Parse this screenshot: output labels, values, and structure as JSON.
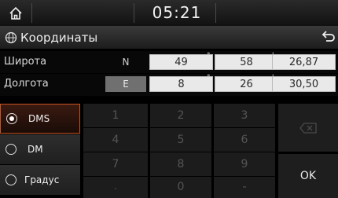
{
  "status": {
    "time": "05:21",
    "home_icon": "home-icon"
  },
  "header": {
    "title": "Координаты",
    "title_icon": "globe-icon",
    "back_icon": "back-arrow-icon"
  },
  "coordinates": {
    "latitude": {
      "label": "Широта",
      "direction": "N",
      "degrees": "49",
      "minutes": "58",
      "seconds": "26,87"
    },
    "longitude": {
      "label": "Долгота",
      "direction": "E",
      "degrees": "8",
      "minutes": "26",
      "seconds": "30,50"
    },
    "units": {
      "degrees": "°",
      "minutes": "'"
    }
  },
  "formats": [
    {
      "label": "DMS",
      "selected": true
    },
    {
      "label": "DM",
      "selected": false
    },
    {
      "label": "Градус",
      "selected": false
    }
  ],
  "keypad": {
    "keys": [
      "1",
      "2",
      "3",
      "4",
      "5",
      "6",
      "7",
      "8",
      "9",
      ".",
      "0",
      "-"
    ],
    "ok_label": "OK",
    "backspace_icon": "backspace-icon"
  },
  "colors": {
    "accent": "#c8531e",
    "field": "#e9e9e9"
  }
}
